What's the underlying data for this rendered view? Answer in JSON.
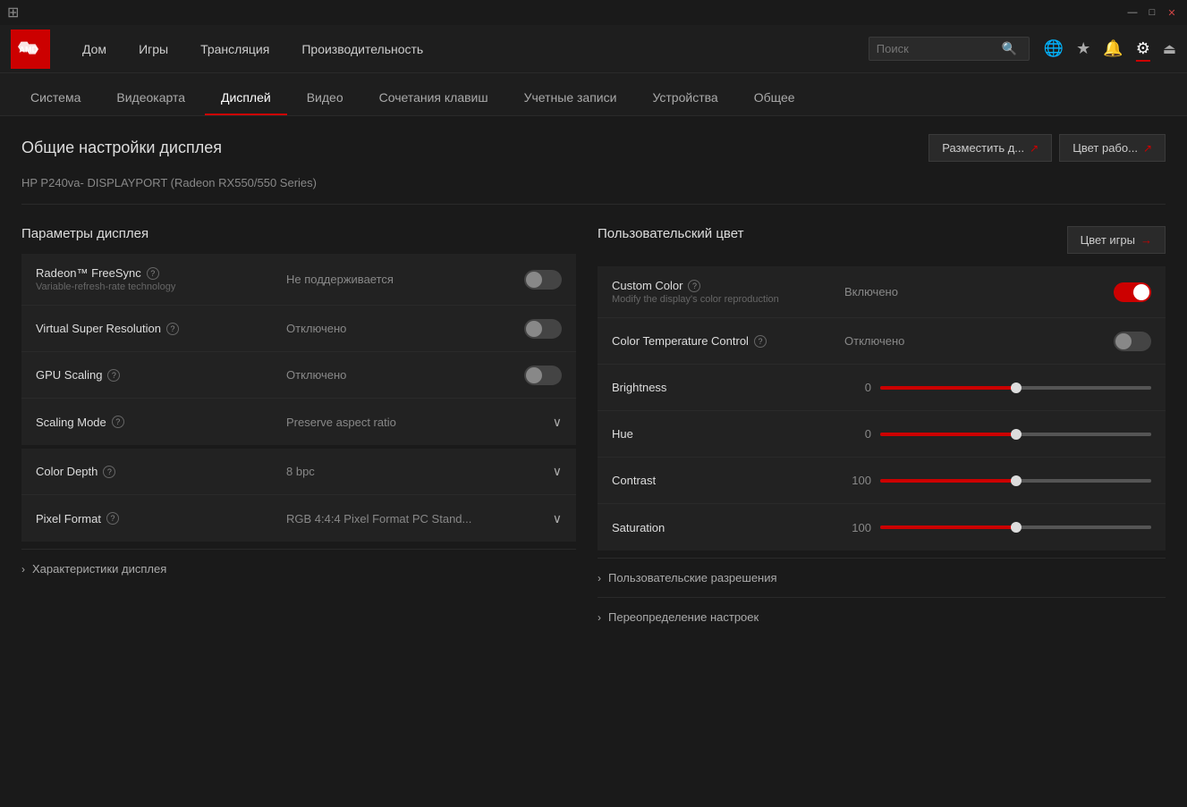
{
  "titleBar": {
    "icon": "⊞",
    "minimizeLabel": "—",
    "maximizeLabel": "□",
    "closeLabel": "✕"
  },
  "topNav": {
    "logoAlt": "AMD",
    "items": [
      {
        "id": "home",
        "label": "Дом"
      },
      {
        "id": "games",
        "label": "Игры"
      },
      {
        "id": "streaming",
        "label": "Трансляция"
      },
      {
        "id": "performance",
        "label": "Производительность"
      }
    ],
    "searchPlaceholder": "Поиск",
    "icons": [
      {
        "id": "globe",
        "symbol": "🌐",
        "active": false
      },
      {
        "id": "star",
        "symbol": "★",
        "active": false
      },
      {
        "id": "bell",
        "symbol": "🔔",
        "active": false
      },
      {
        "id": "gear",
        "symbol": "⚙",
        "active": true
      },
      {
        "id": "exit",
        "symbol": "⏏",
        "active": false
      }
    ]
  },
  "tabs": [
    {
      "id": "system",
      "label": "Система",
      "active": false
    },
    {
      "id": "gpu",
      "label": "Видеокарта",
      "active": false
    },
    {
      "id": "display",
      "label": "Дисплей",
      "active": true
    },
    {
      "id": "video",
      "label": "Видео",
      "active": false
    },
    {
      "id": "hotkeys",
      "label": "Сочетания клавиш",
      "active": false
    },
    {
      "id": "accounts",
      "label": "Учетные записи",
      "active": false
    },
    {
      "id": "devices",
      "label": "Устройства",
      "active": false
    },
    {
      "id": "general",
      "label": "Общее",
      "active": false
    }
  ],
  "pageHeader": {
    "title": "Общие настройки дисплея",
    "buttons": [
      {
        "id": "arrange",
        "label": "Разместить д..."
      },
      {
        "id": "color-work",
        "label": "Цвет рабо..."
      }
    ]
  },
  "monitorInfo": {
    "label": "HP P240va- DISPLAYPORT (Radeon RX550/550 Series)"
  },
  "leftPanel": {
    "sectionTitle": "Параметры дисплея",
    "settings": [
      {
        "id": "freesync",
        "label": "Radeon™ FreeSync",
        "subLabel": "Variable-refresh-rate technology",
        "hasHelp": true,
        "value": "Не поддерживается",
        "controlType": "toggle",
        "toggleState": "off"
      },
      {
        "id": "vsr",
        "label": "Virtual Super Resolution",
        "subLabel": "",
        "hasHelp": true,
        "value": "Отключено",
        "controlType": "toggle",
        "toggleState": "off"
      },
      {
        "id": "gpu-scaling",
        "label": "GPU Scaling",
        "subLabel": "",
        "hasHelp": true,
        "value": "Отключено",
        "controlType": "toggle",
        "toggleState": "off"
      },
      {
        "id": "scaling-mode",
        "label": "Scaling Mode",
        "subLabel": "",
        "hasHelp": true,
        "value": "Preserve aspect ratio",
        "controlType": "dropdown"
      }
    ],
    "settings2": [
      {
        "id": "color-depth",
        "label": "Color Depth",
        "subLabel": "",
        "hasHelp": true,
        "value": "8 bpc",
        "controlType": "dropdown"
      },
      {
        "id": "pixel-format",
        "label": "Pixel Format",
        "subLabel": "",
        "hasHelp": true,
        "value": "RGB 4:4:4 Pixel Format PC Stand...",
        "controlType": "dropdown"
      }
    ],
    "collapseSection": {
      "label": "Характеристики дисплея"
    }
  },
  "rightPanel": {
    "sectionTitle": "Пользовательский цвет",
    "gameColorBtn": "Цвет игры",
    "settings": [
      {
        "id": "custom-color",
        "label": "Custom Color",
        "subLabel": "Modify the display's color reproduction",
        "hasHelp": true,
        "value": "Включено",
        "controlType": "toggle",
        "toggleState": "on"
      },
      {
        "id": "color-temp",
        "label": "Color Temperature Control",
        "subLabel": "",
        "hasHelp": true,
        "value": "Отключено",
        "controlType": "toggle",
        "toggleState": "off"
      },
      {
        "id": "brightness",
        "label": "Brightness",
        "value": "0",
        "controlType": "slider",
        "sliderPercent": 50
      },
      {
        "id": "hue",
        "label": "Hue",
        "value": "0",
        "controlType": "slider",
        "sliderPercent": 50
      },
      {
        "id": "contrast",
        "label": "Contrast",
        "value": "100",
        "controlType": "slider",
        "sliderPercent": 50
      },
      {
        "id": "saturation",
        "label": "Saturation",
        "value": "100",
        "controlType": "slider",
        "sliderPercent": 50
      }
    ],
    "collapseSections": [
      {
        "id": "custom-res",
        "label": "Пользовательские разрешения"
      },
      {
        "id": "override",
        "label": "Переопределение настроек"
      }
    ]
  }
}
